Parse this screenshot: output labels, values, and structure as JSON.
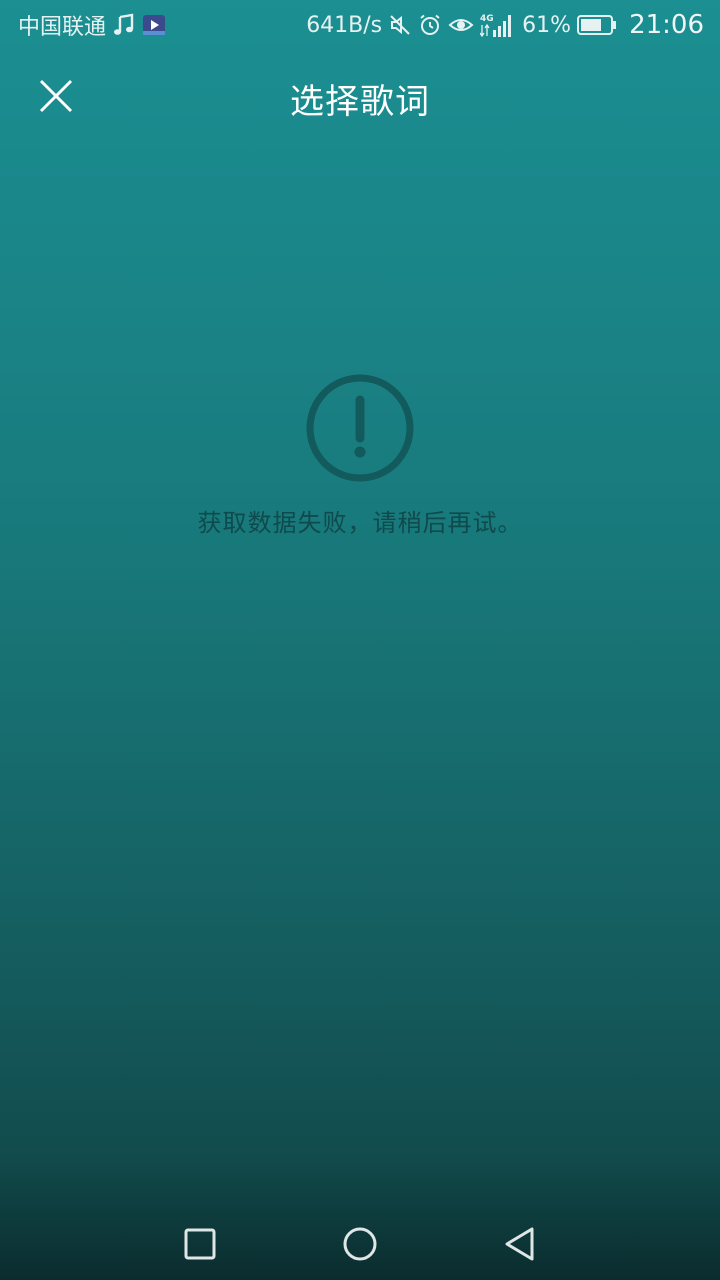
{
  "status_bar": {
    "carrier": "中国联通",
    "net_speed": "641B/s",
    "signal_label": "4G",
    "battery_percent": "61%",
    "time": "21:06",
    "icons": [
      "music-note-icon",
      "video-app-icon",
      "mute-icon",
      "alarm-icon",
      "eye-icon",
      "signal-icon",
      "battery-icon"
    ]
  },
  "header": {
    "title": "选择歌词",
    "close_icon": "close-icon"
  },
  "content": {
    "error_icon": "exclamation-circle-icon",
    "error_message": "获取数据失败，请稍后再试。"
  },
  "nav_bar": {
    "buttons": [
      "recent-apps-icon",
      "home-icon",
      "back-icon"
    ]
  },
  "colors": {
    "gradient_top": "#1b8f92",
    "gradient_bottom": "#0b2c2e",
    "error_icon_color": "#125a5c",
    "error_text_color": "#0f4a4c"
  }
}
